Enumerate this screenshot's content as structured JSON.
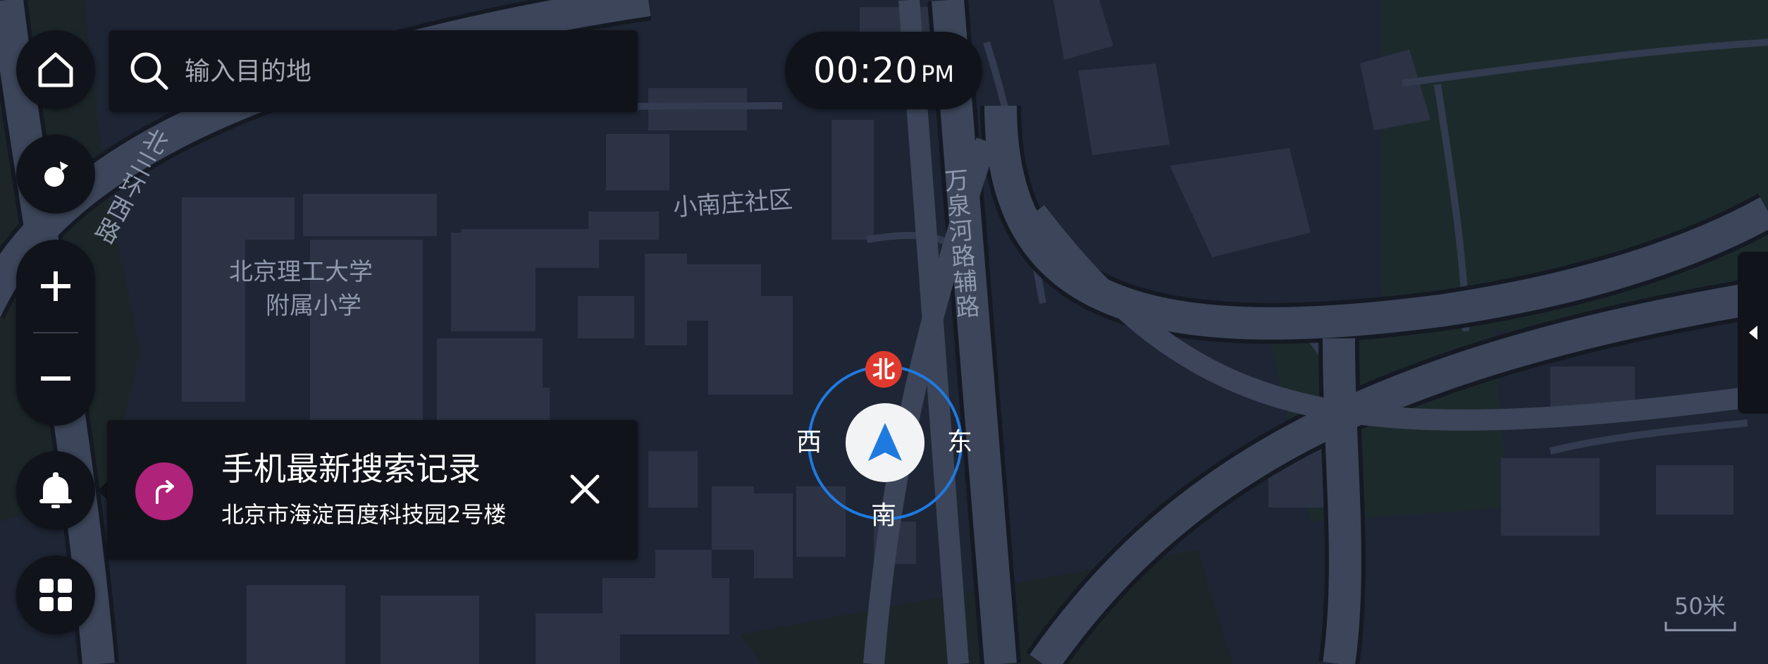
{
  "search": {
    "placeholder": "输入目的地"
  },
  "clock": {
    "time": "00:20",
    "ampm": "PM"
  },
  "notification": {
    "title": "手机最新搜索记录",
    "address": "北京市海淀百度科技园2号楼",
    "icon_color": "#b0237a"
  },
  "map_labels": {
    "school_line1": "北京理工大学",
    "school_line2": "附属小学",
    "community": "小南庄社区",
    "road_west_ring": "北三环西路",
    "road_wanquanhe": "万泉河路辅路"
  },
  "compass": {
    "north": "北",
    "south": "南",
    "east": "东",
    "west": "西",
    "ring_color": "#1f7ae0",
    "north_color": "#e03a2f"
  },
  "scale": {
    "label": "50米"
  },
  "icons": {
    "home": "home-icon",
    "location": "location-icon",
    "zoom_in": "plus-icon",
    "zoom_out": "minus-icon",
    "notification": "bell-icon",
    "apps": "grid-icon",
    "search": "search-icon",
    "route": "turn-right-icon",
    "close": "close-icon",
    "collapse": "triangle-left-icon",
    "navigation_arrow": "navigation-arrow-icon"
  }
}
